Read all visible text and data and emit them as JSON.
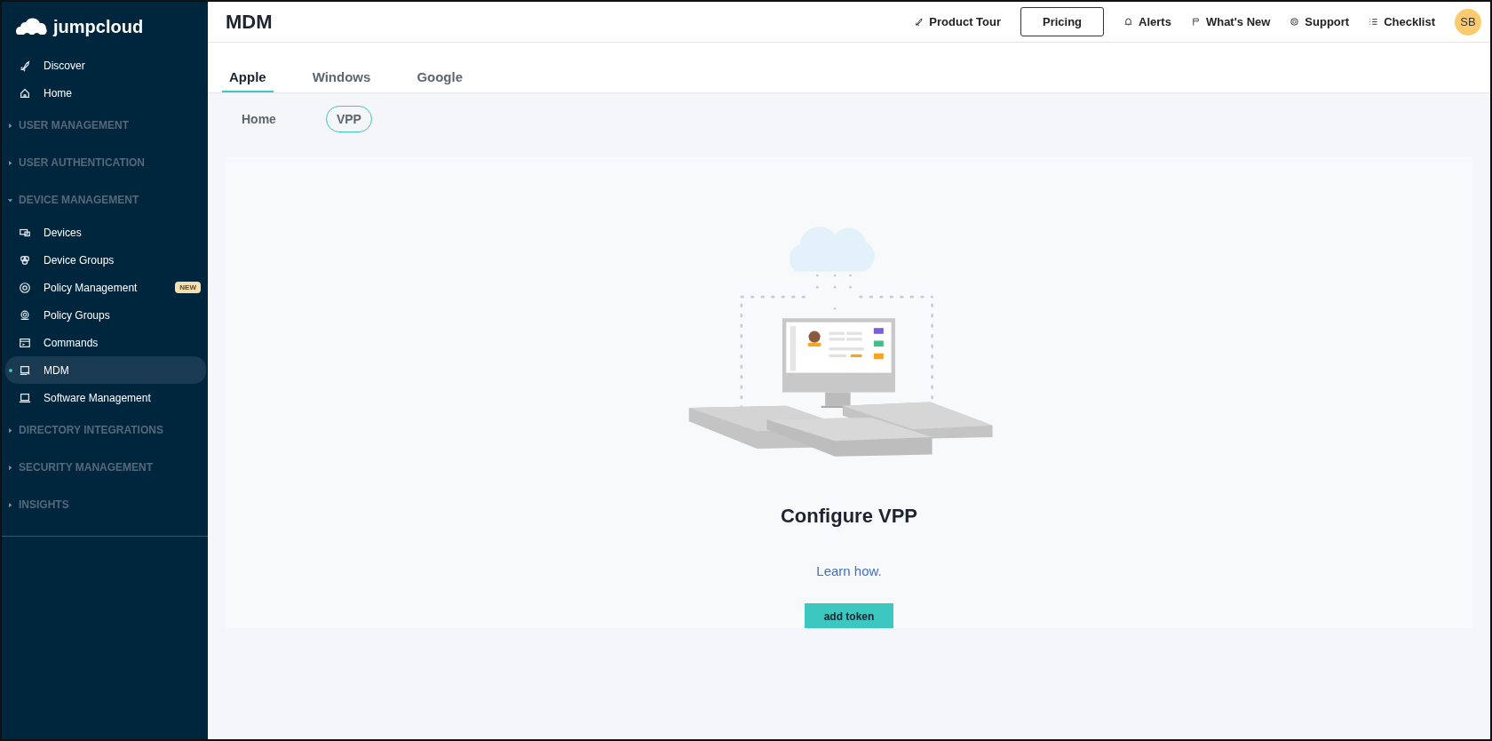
{
  "sidebar": {
    "logo": "jumpcloud",
    "items": [
      {
        "kind": "link",
        "label": "Discover",
        "selected": false
      },
      {
        "kind": "link",
        "label": "Home",
        "selected": false
      },
      {
        "kind": "section",
        "label": "USER MANAGEMENT",
        "expanded": false
      },
      {
        "kind": "section",
        "label": "USER AUTHENTICATION",
        "expanded": false
      },
      {
        "kind": "section",
        "label": "DEVICE MANAGEMENT",
        "expanded": true,
        "children": [
          {
            "label": "Devices",
            "selected": false
          },
          {
            "label": "Device Groups",
            "selected": false
          },
          {
            "label": "Policy Management",
            "selected": false,
            "badge": "NEW"
          },
          {
            "label": "Policy Groups",
            "selected": false
          },
          {
            "label": "Commands",
            "selected": false
          },
          {
            "label": "MDM",
            "selected": true
          },
          {
            "label": "Software Management",
            "selected": false
          }
        ]
      },
      {
        "kind": "section",
        "label": "DIRECTORY INTEGRATIONS",
        "expanded": false
      },
      {
        "kind": "section",
        "label": "SECURITY MANAGEMENT",
        "expanded": false
      },
      {
        "kind": "section",
        "label": "INSIGHTS",
        "expanded": false
      }
    ]
  },
  "header": {
    "title": "MDM",
    "actions": [
      {
        "kind": "link",
        "label": "Product Tour"
      },
      {
        "kind": "button",
        "label": "Pricing"
      },
      {
        "kind": "link",
        "label": "Alerts"
      },
      {
        "kind": "link",
        "label": "What's New"
      },
      {
        "kind": "link",
        "label": "Support"
      },
      {
        "kind": "link",
        "label": "Checklist"
      }
    ],
    "avatar": "SB"
  },
  "tabs": [
    {
      "label": "Apple",
      "selected": true
    },
    {
      "label": "Windows",
      "selected": false
    },
    {
      "label": "Google",
      "selected": false
    }
  ],
  "subtabs": [
    {
      "label": "Home",
      "selected": false
    },
    {
      "label": "VPP",
      "selected": true
    }
  ],
  "panel": {
    "heading": "Configure VPP",
    "link": "Learn how.",
    "button": "add token"
  }
}
